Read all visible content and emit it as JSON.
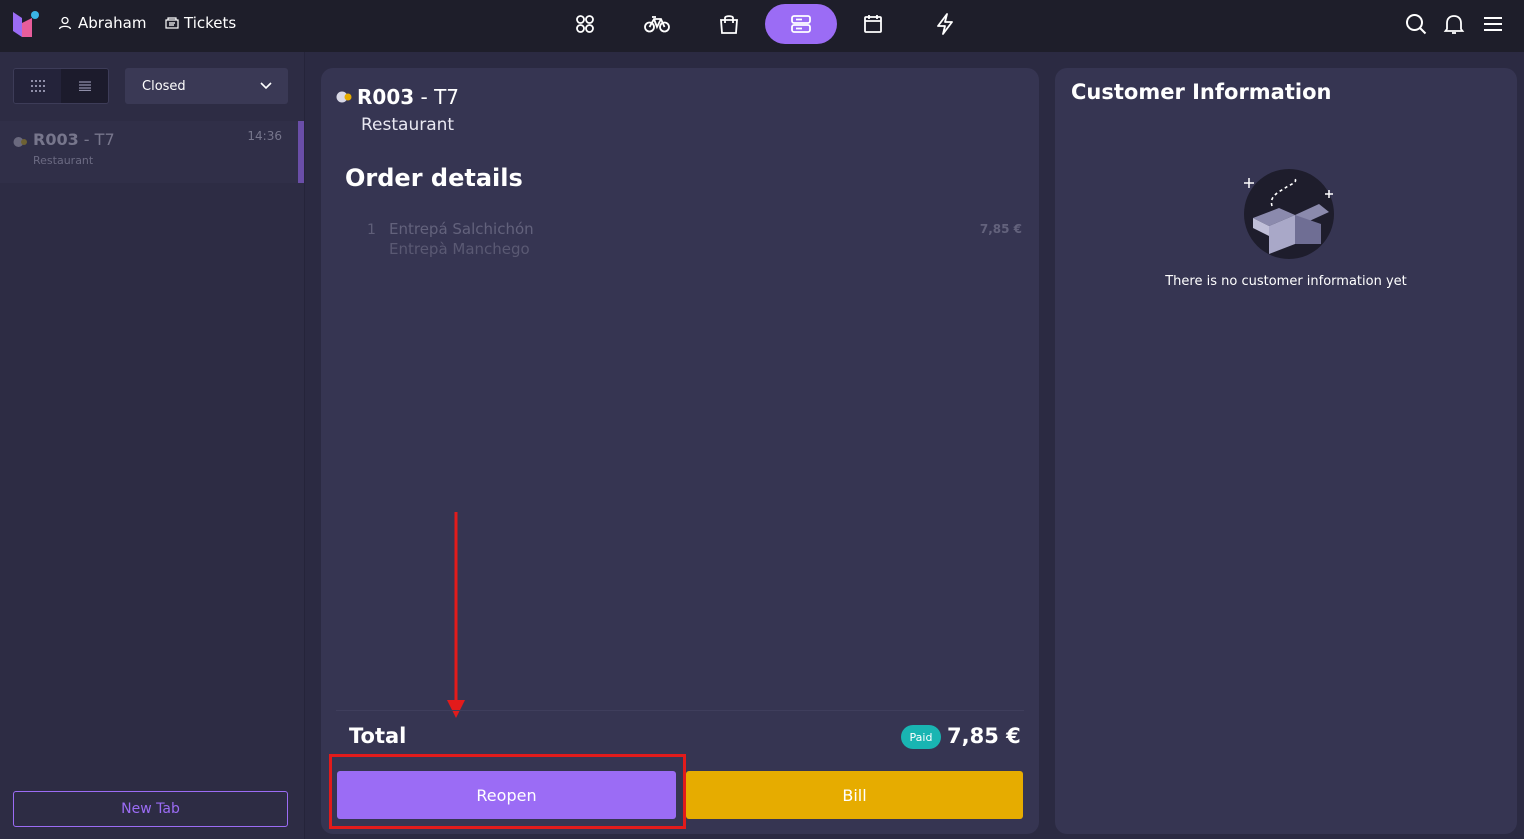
{
  "topbar": {
    "user_name": "Abraham",
    "tickets_label": "Tickets",
    "nav_icons": [
      "apps-icon",
      "bicycle-icon",
      "shopping-bag-icon",
      "server-icon",
      "calendar-icon",
      "lightning-icon"
    ],
    "active_nav": "server-icon",
    "right_icons": [
      "search-icon",
      "bell-icon",
      "menu-icon"
    ],
    "accent_color": "#9b6cf5"
  },
  "sidebar": {
    "status_filter": "Closed",
    "tickets": [
      {
        "code": "R003",
        "table": "T7",
        "location": "Restaurant",
        "time": "14:36"
      }
    ],
    "new_tab_label": "New Tab"
  },
  "order": {
    "code": "R003",
    "separator": " - ",
    "table": "T7",
    "location": "Restaurant",
    "title": "Order details",
    "items": [
      {
        "qty": "1",
        "name": "Entrepá Salchichón",
        "modifier": "Entrepà Manchego",
        "price": "7,85 €"
      }
    ],
    "total_label": "Total",
    "paid_badge": "Paid",
    "total_amount": "7,85 €",
    "reopen_label": "Reopen",
    "bill_label": "Bill",
    "paid_color": "#19b5b2",
    "bill_color": "#e6ac00"
  },
  "customer": {
    "title": "Customer Information",
    "empty_text": "There is no customer information yet"
  }
}
